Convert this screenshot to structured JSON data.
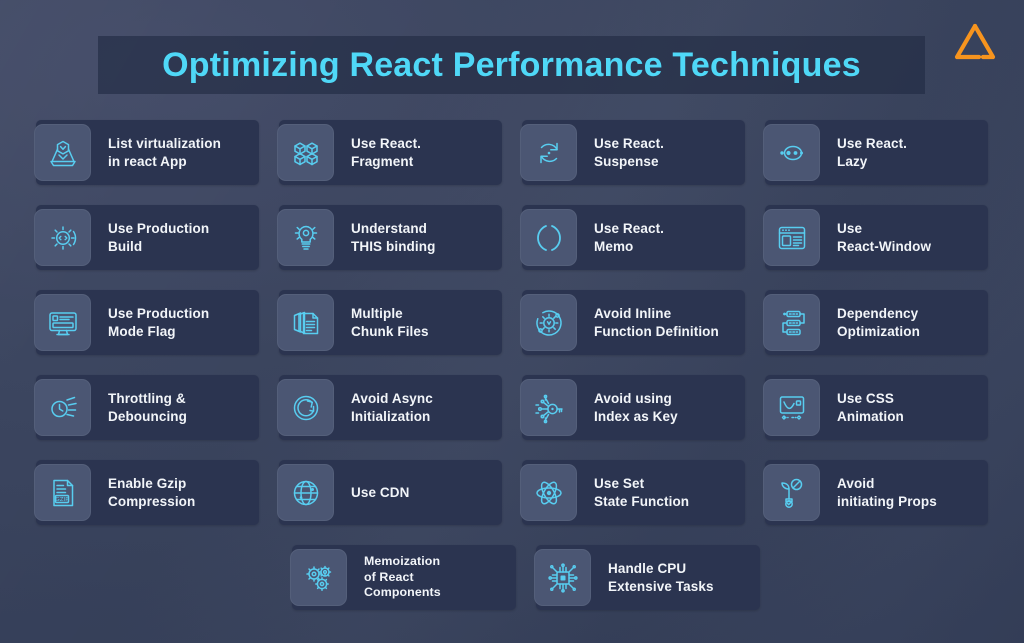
{
  "header": {
    "title": "Optimizing React Performance Techniques",
    "logo_name": "triangle-logo",
    "logo_color": "#f7941e",
    "title_color": "#4fd8f7"
  },
  "theme": {
    "page_background": "#39455f",
    "card_background": "#2b3450",
    "icon_tile_background": "#4b5673",
    "icon_stroke": "#58cdf0",
    "label_color": "#f2f5f9"
  },
  "grid": {
    "rows": [
      {
        "cards": [
          {
            "label": "List virtualization\nin react App",
            "icon": "virtualization-icon"
          },
          {
            "label": "Use React.\nFragment",
            "icon": "blocks-icon"
          },
          {
            "label": "Use React.\nSuspense",
            "icon": "refresh-cycle-icon"
          },
          {
            "label": "Use React.\nLazy",
            "icon": "orbit-dots-icon"
          }
        ]
      },
      {
        "cards": [
          {
            "label": "Use Production\nBuild",
            "icon": "gear-code-icon"
          },
          {
            "label": "Understand\nTHIS binding",
            "icon": "lightbulb-idea-icon"
          },
          {
            "label": "Use React.\nMemo",
            "icon": "parentheses-icon"
          },
          {
            "label": "Use\nReact-Window",
            "icon": "browser-window-icon"
          }
        ]
      },
      {
        "cards": [
          {
            "label": "Use Production\nMode Flag",
            "icon": "monitor-icon"
          },
          {
            "label": "Multiple\nChunk Files",
            "icon": "stacked-files-icon"
          },
          {
            "label": "Avoid Inline\nFunction Definition",
            "icon": "gear-orbit-icon"
          },
          {
            "label": "Dependency\nOptimization",
            "icon": "dependency-nodes-icon"
          }
        ]
      },
      {
        "cards": [
          {
            "label": "Throttling &\nDebouncing",
            "icon": "speed-clock-icon"
          },
          {
            "label": "Avoid Async\nInitialization",
            "icon": "circular-arrow-icon"
          },
          {
            "label": "Avoid using\nIndex as Key",
            "icon": "circuit-key-icon"
          },
          {
            "label": "Use CSS\nAnimation",
            "icon": "animation-curve-icon"
          }
        ]
      },
      {
        "cards": [
          {
            "label": "Enable Gzip\nCompression",
            "icon": "gzip-file-icon"
          },
          {
            "label": "Use CDN",
            "icon": "globe-icon"
          },
          {
            "label": "Use Set\nState Function",
            "icon": "react-atom-icon"
          },
          {
            "label": "Avoid\ninitiating Props",
            "icon": "no-sprout-icon"
          }
        ]
      },
      {
        "last": true,
        "cards": [
          {
            "label": "Memoization\nof React\nComponents",
            "icon": "gears-memo-icon",
            "small": true
          },
          {
            "label": "Handle CPU\nExtensive Tasks",
            "icon": "cpu-chip-icon"
          }
        ]
      }
    ]
  }
}
